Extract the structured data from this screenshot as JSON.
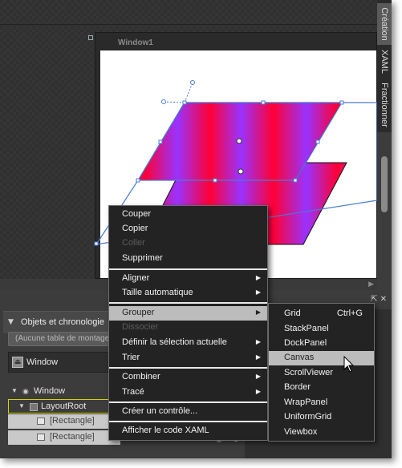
{
  "artboard": {
    "window_title": "Window1"
  },
  "right_tabs": [
    "Création",
    "XAML",
    "Fractionner"
  ],
  "objects_panel": {
    "title": "Objets et chronologie",
    "storyboard_placeholder": "(Aucune table de montage)",
    "scope_label": "Window",
    "tree": [
      {
        "label": "Window"
      },
      {
        "label": "LayoutRoot"
      },
      {
        "label": "[Rectangle]"
      },
      {
        "label": "[Rectangle]"
      }
    ]
  },
  "context_menu": {
    "items": [
      {
        "label": "Couper"
      },
      {
        "label": "Copier"
      },
      {
        "label": "Coller",
        "disabled": true
      },
      {
        "label": "Supprimer"
      },
      {
        "label": "Aligner",
        "submenu": true
      },
      {
        "label": "Taille automatique",
        "submenu": true
      },
      {
        "label": "Grouper",
        "submenu": true,
        "highlighted": true
      },
      {
        "label": "Dissocier",
        "disabled": true
      },
      {
        "label": "Définir la sélection actuelle",
        "submenu": true
      },
      {
        "label": "Trier",
        "submenu": true
      },
      {
        "label": "Combiner",
        "submenu": true
      },
      {
        "label": "Tracé",
        "submenu": true
      },
      {
        "label": "Créer un contrôle..."
      },
      {
        "label": "Afficher le code XAML"
      }
    ]
  },
  "group_submenu": {
    "items": [
      {
        "label": "Grid",
        "shortcut": "Ctrl+G"
      },
      {
        "label": "StackPanel"
      },
      {
        "label": "DockPanel"
      },
      {
        "label": "Canvas",
        "highlighted": true
      },
      {
        "label": "ScrollViewer"
      },
      {
        "label": "Border"
      },
      {
        "label": "WrapPanel"
      },
      {
        "label": "UniformGrid"
      },
      {
        "label": "Viewbox"
      }
    ]
  },
  "colors": {
    "gradient_red": "#ff0033",
    "gradient_purple": "#9933ff",
    "selection_blue": "#4a7bd6",
    "menu_bg": "#232323",
    "menu_highlight": "#bcbcbc"
  }
}
